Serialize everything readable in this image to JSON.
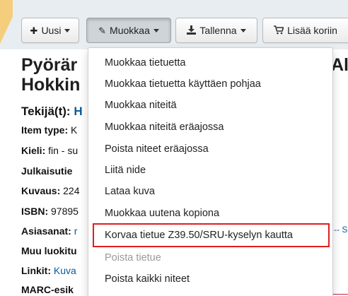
{
  "toolbar": {
    "new_label": "Uusi",
    "edit_label": "Muokkaa",
    "save_label": "Tallenna",
    "cart_label": "Lisää koriin"
  },
  "record": {
    "title_line1": "Pyörär",
    "title_line2": "Hokkin",
    "title_right": "Al",
    "author_label": "Tekijä(t):",
    "author_value": "H",
    "fields": [
      {
        "label": "Item type:",
        "value": "K"
      },
      {
        "label": "Kieli:",
        "value": "fin - su"
      },
      {
        "label": "Julkaisutie",
        "value": ""
      },
      {
        "label": "Kuvaus:",
        "value": "224"
      },
      {
        "label": "ISBN:",
        "value": "97895"
      },
      {
        "label": "Asiasanat:",
        "value": "r"
      },
      {
        "label": "Muu luokitu",
        "value": ""
      },
      {
        "label": "Linkit:",
        "value": "Kuva"
      },
      {
        "label": "MARC-esik",
        "value": ""
      }
    ],
    "right_fragment": "-- S"
  },
  "edit_menu": {
    "items": [
      {
        "label": "Muokkaa tietuetta",
        "disabled": false
      },
      {
        "label": "Muokkaa tietuetta käyttäen pohjaa",
        "disabled": false
      },
      {
        "label": "Muokkaa niteitä",
        "disabled": false
      },
      {
        "label": "Muokkaa niteitä eräajossa",
        "disabled": false
      },
      {
        "label": "Poista niteet eräajossa",
        "disabled": false
      },
      {
        "label": "Liitä nide",
        "disabled": false
      },
      {
        "label": "Lataa kuva",
        "disabled": false
      },
      {
        "label": "Muokkaa uutena kopiona",
        "disabled": false
      },
      {
        "label": "Korvaa tietue Z39.50/SRU-kyselyn kautta",
        "disabled": false,
        "highlighted": true
      },
      {
        "label": "Poista tietue",
        "disabled": true
      },
      {
        "label": "Poista kaikki niteet",
        "disabled": false
      }
    ]
  },
  "colors": {
    "link": "#0c5b97",
    "highlight_border": "#e01e1e",
    "toolbar_bg": "#e8edf1",
    "accent_tab": "#f4ce7c"
  },
  "icons": {
    "new": "plus-icon",
    "edit": "pencil-icon",
    "save": "download-icon",
    "cart": "cart-icon"
  }
}
